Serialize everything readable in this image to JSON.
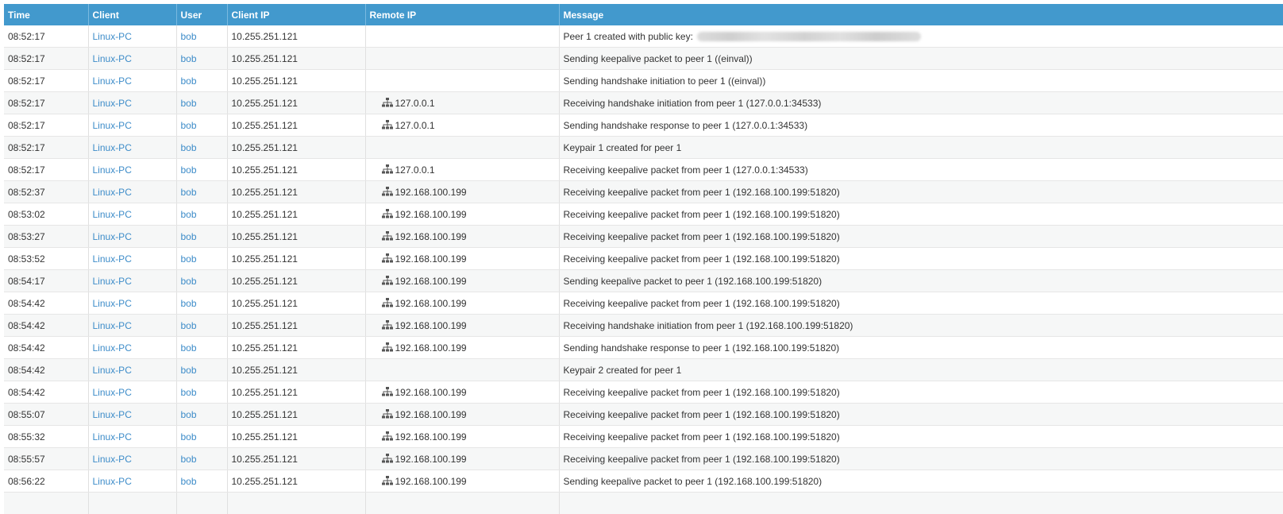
{
  "table": {
    "columns": [
      "Time",
      "Client",
      "User",
      "Client IP",
      "Remote IP",
      "Message"
    ],
    "rows": [
      {
        "time": "08:52:17",
        "client": "Linux-PC",
        "user": "bob",
        "client_ip": "10.255.251.121",
        "remote_ip": "",
        "message": "Peer 1 created with public key:",
        "blurred_key": true
      },
      {
        "time": "08:52:17",
        "client": "Linux-PC",
        "user": "bob",
        "client_ip": "10.255.251.121",
        "remote_ip": "",
        "message": "Sending keepalive packet to peer 1 ((einval))"
      },
      {
        "time": "08:52:17",
        "client": "Linux-PC",
        "user": "bob",
        "client_ip": "10.255.251.121",
        "remote_ip": "",
        "message": "Sending handshake initiation to peer 1 ((einval))"
      },
      {
        "time": "08:52:17",
        "client": "Linux-PC",
        "user": "bob",
        "client_ip": "10.255.251.121",
        "remote_ip": "127.0.0.1",
        "message": "Receiving handshake initiation from peer 1 (127.0.0.1:34533)"
      },
      {
        "time": "08:52:17",
        "client": "Linux-PC",
        "user": "bob",
        "client_ip": "10.255.251.121",
        "remote_ip": "127.0.0.1",
        "message": "Sending handshake response to peer 1 (127.0.0.1:34533)"
      },
      {
        "time": "08:52:17",
        "client": "Linux-PC",
        "user": "bob",
        "client_ip": "10.255.251.121",
        "remote_ip": "",
        "message": "Keypair 1 created for peer 1"
      },
      {
        "time": "08:52:17",
        "client": "Linux-PC",
        "user": "bob",
        "client_ip": "10.255.251.121",
        "remote_ip": "127.0.0.1",
        "message": "Receiving keepalive packet from peer 1 (127.0.0.1:34533)"
      },
      {
        "time": "08:52:37",
        "client": "Linux-PC",
        "user": "bob",
        "client_ip": "10.255.251.121",
        "remote_ip": "192.168.100.199",
        "message": "Receiving keepalive packet from peer 1 (192.168.100.199:51820)"
      },
      {
        "time": "08:53:02",
        "client": "Linux-PC",
        "user": "bob",
        "client_ip": "10.255.251.121",
        "remote_ip": "192.168.100.199",
        "message": "Receiving keepalive packet from peer 1 (192.168.100.199:51820)"
      },
      {
        "time": "08:53:27",
        "client": "Linux-PC",
        "user": "bob",
        "client_ip": "10.255.251.121",
        "remote_ip": "192.168.100.199",
        "message": "Receiving keepalive packet from peer 1 (192.168.100.199:51820)"
      },
      {
        "time": "08:53:52",
        "client": "Linux-PC",
        "user": "bob",
        "client_ip": "10.255.251.121",
        "remote_ip": "192.168.100.199",
        "message": "Receiving keepalive packet from peer 1 (192.168.100.199:51820)"
      },
      {
        "time": "08:54:17",
        "client": "Linux-PC",
        "user": "bob",
        "client_ip": "10.255.251.121",
        "remote_ip": "192.168.100.199",
        "message": "Sending keepalive packet to peer 1 (192.168.100.199:51820)"
      },
      {
        "time": "08:54:42",
        "client": "Linux-PC",
        "user": "bob",
        "client_ip": "10.255.251.121",
        "remote_ip": "192.168.100.199",
        "message": "Receiving keepalive packet from peer 1 (192.168.100.199:51820)"
      },
      {
        "time": "08:54:42",
        "client": "Linux-PC",
        "user": "bob",
        "client_ip": "10.255.251.121",
        "remote_ip": "192.168.100.199",
        "message": "Receiving handshake initiation from peer 1 (192.168.100.199:51820)"
      },
      {
        "time": "08:54:42",
        "client": "Linux-PC",
        "user": "bob",
        "client_ip": "10.255.251.121",
        "remote_ip": "192.168.100.199",
        "message": "Sending handshake response to peer 1 (192.168.100.199:51820)"
      },
      {
        "time": "08:54:42",
        "client": "Linux-PC",
        "user": "bob",
        "client_ip": "10.255.251.121",
        "remote_ip": "",
        "message": "Keypair 2 created for peer 1"
      },
      {
        "time": "08:54:42",
        "client": "Linux-PC",
        "user": "bob",
        "client_ip": "10.255.251.121",
        "remote_ip": "192.168.100.199",
        "message": "Receiving keepalive packet from peer 1 (192.168.100.199:51820)"
      },
      {
        "time": "08:55:07",
        "client": "Linux-PC",
        "user": "bob",
        "client_ip": "10.255.251.121",
        "remote_ip": "192.168.100.199",
        "message": "Receiving keepalive packet from peer 1 (192.168.100.199:51820)"
      },
      {
        "time": "08:55:32",
        "client": "Linux-PC",
        "user": "bob",
        "client_ip": "10.255.251.121",
        "remote_ip": "192.168.100.199",
        "message": "Receiving keepalive packet from peer 1 (192.168.100.199:51820)"
      },
      {
        "time": "08:55:57",
        "client": "Linux-PC",
        "user": "bob",
        "client_ip": "10.255.251.121",
        "remote_ip": "192.168.100.199",
        "message": "Receiving keepalive packet from peer 1 (192.168.100.199:51820)"
      },
      {
        "time": "08:56:22",
        "client": "Linux-PC",
        "user": "bob",
        "client_ip": "10.255.251.121",
        "remote_ip": "192.168.100.199",
        "message": "Sending keepalive packet to peer 1 (192.168.100.199:51820)"
      },
      {
        "time": "",
        "client": "",
        "user": "",
        "client_ip": "",
        "remote_ip": "",
        "message": ""
      }
    ]
  },
  "icons": {
    "remote_ip": "network-icon"
  },
  "colors": {
    "header_bg": "#4299cd",
    "header_text": "#ffffff",
    "link": "#3d8cc9",
    "row_alt": "#f6f7f7"
  }
}
